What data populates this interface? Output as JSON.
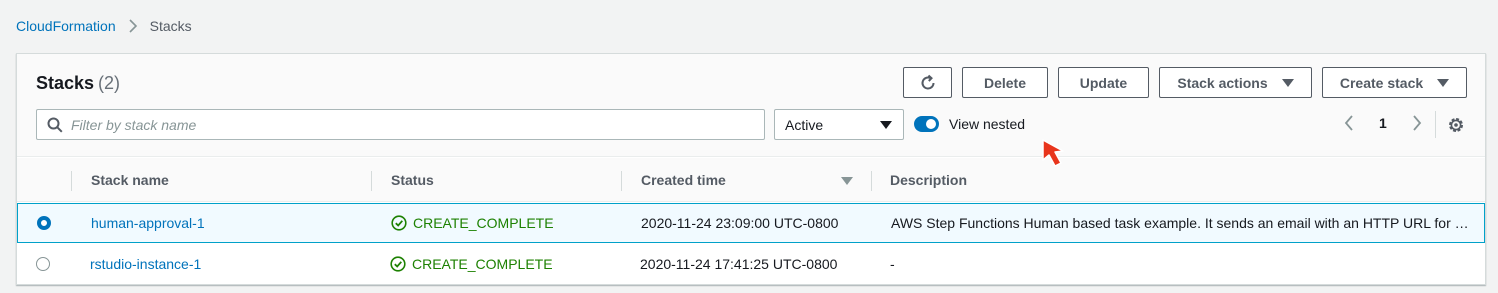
{
  "breadcrumb": {
    "root": "CloudFormation",
    "current": "Stacks"
  },
  "panel": {
    "title": "Stacks",
    "count": "(2)"
  },
  "toolbar": {
    "delete_label": "Delete",
    "update_label": "Update",
    "stack_actions_label": "Stack actions",
    "create_stack_label": "Create stack"
  },
  "filter": {
    "placeholder": "Filter by stack name",
    "value": "",
    "status_select": "Active",
    "view_nested_label": "View nested",
    "view_nested_on": true
  },
  "pagination": {
    "current_page": "1"
  },
  "table": {
    "columns": [
      "Stack name",
      "Status",
      "Created time",
      "Description"
    ],
    "sorted_column": "Created time",
    "sort_direction": "descending",
    "rows": [
      {
        "selected": true,
        "name": "human-approval-1",
        "status": "CREATE_COMPLETE",
        "created": "2020-11-24 23:09:00 UTC-0800",
        "description": "AWS Step Functions Human based task example. It sends an email with an HTTP URL for approval."
      },
      {
        "selected": false,
        "name": "rstudio-instance-1",
        "status": "CREATE_COMPLETE",
        "created": "2020-11-24 17:41:25 UTC-0800",
        "description": "-"
      }
    ]
  },
  "colors": {
    "link": "#0073bb",
    "success": "#1d8102",
    "selected_border": "#00a1c9",
    "annotation_arrow": "#e8351c"
  },
  "icons": {
    "breadcrumb_separator": "chevron-right-icon",
    "refresh": "refresh-icon",
    "search": "search-icon",
    "prev": "chevron-left-icon",
    "next": "chevron-right-icon",
    "settings": "gear-icon",
    "status": "check-circle-icon",
    "pointer": "arrow-cursor-icon"
  }
}
